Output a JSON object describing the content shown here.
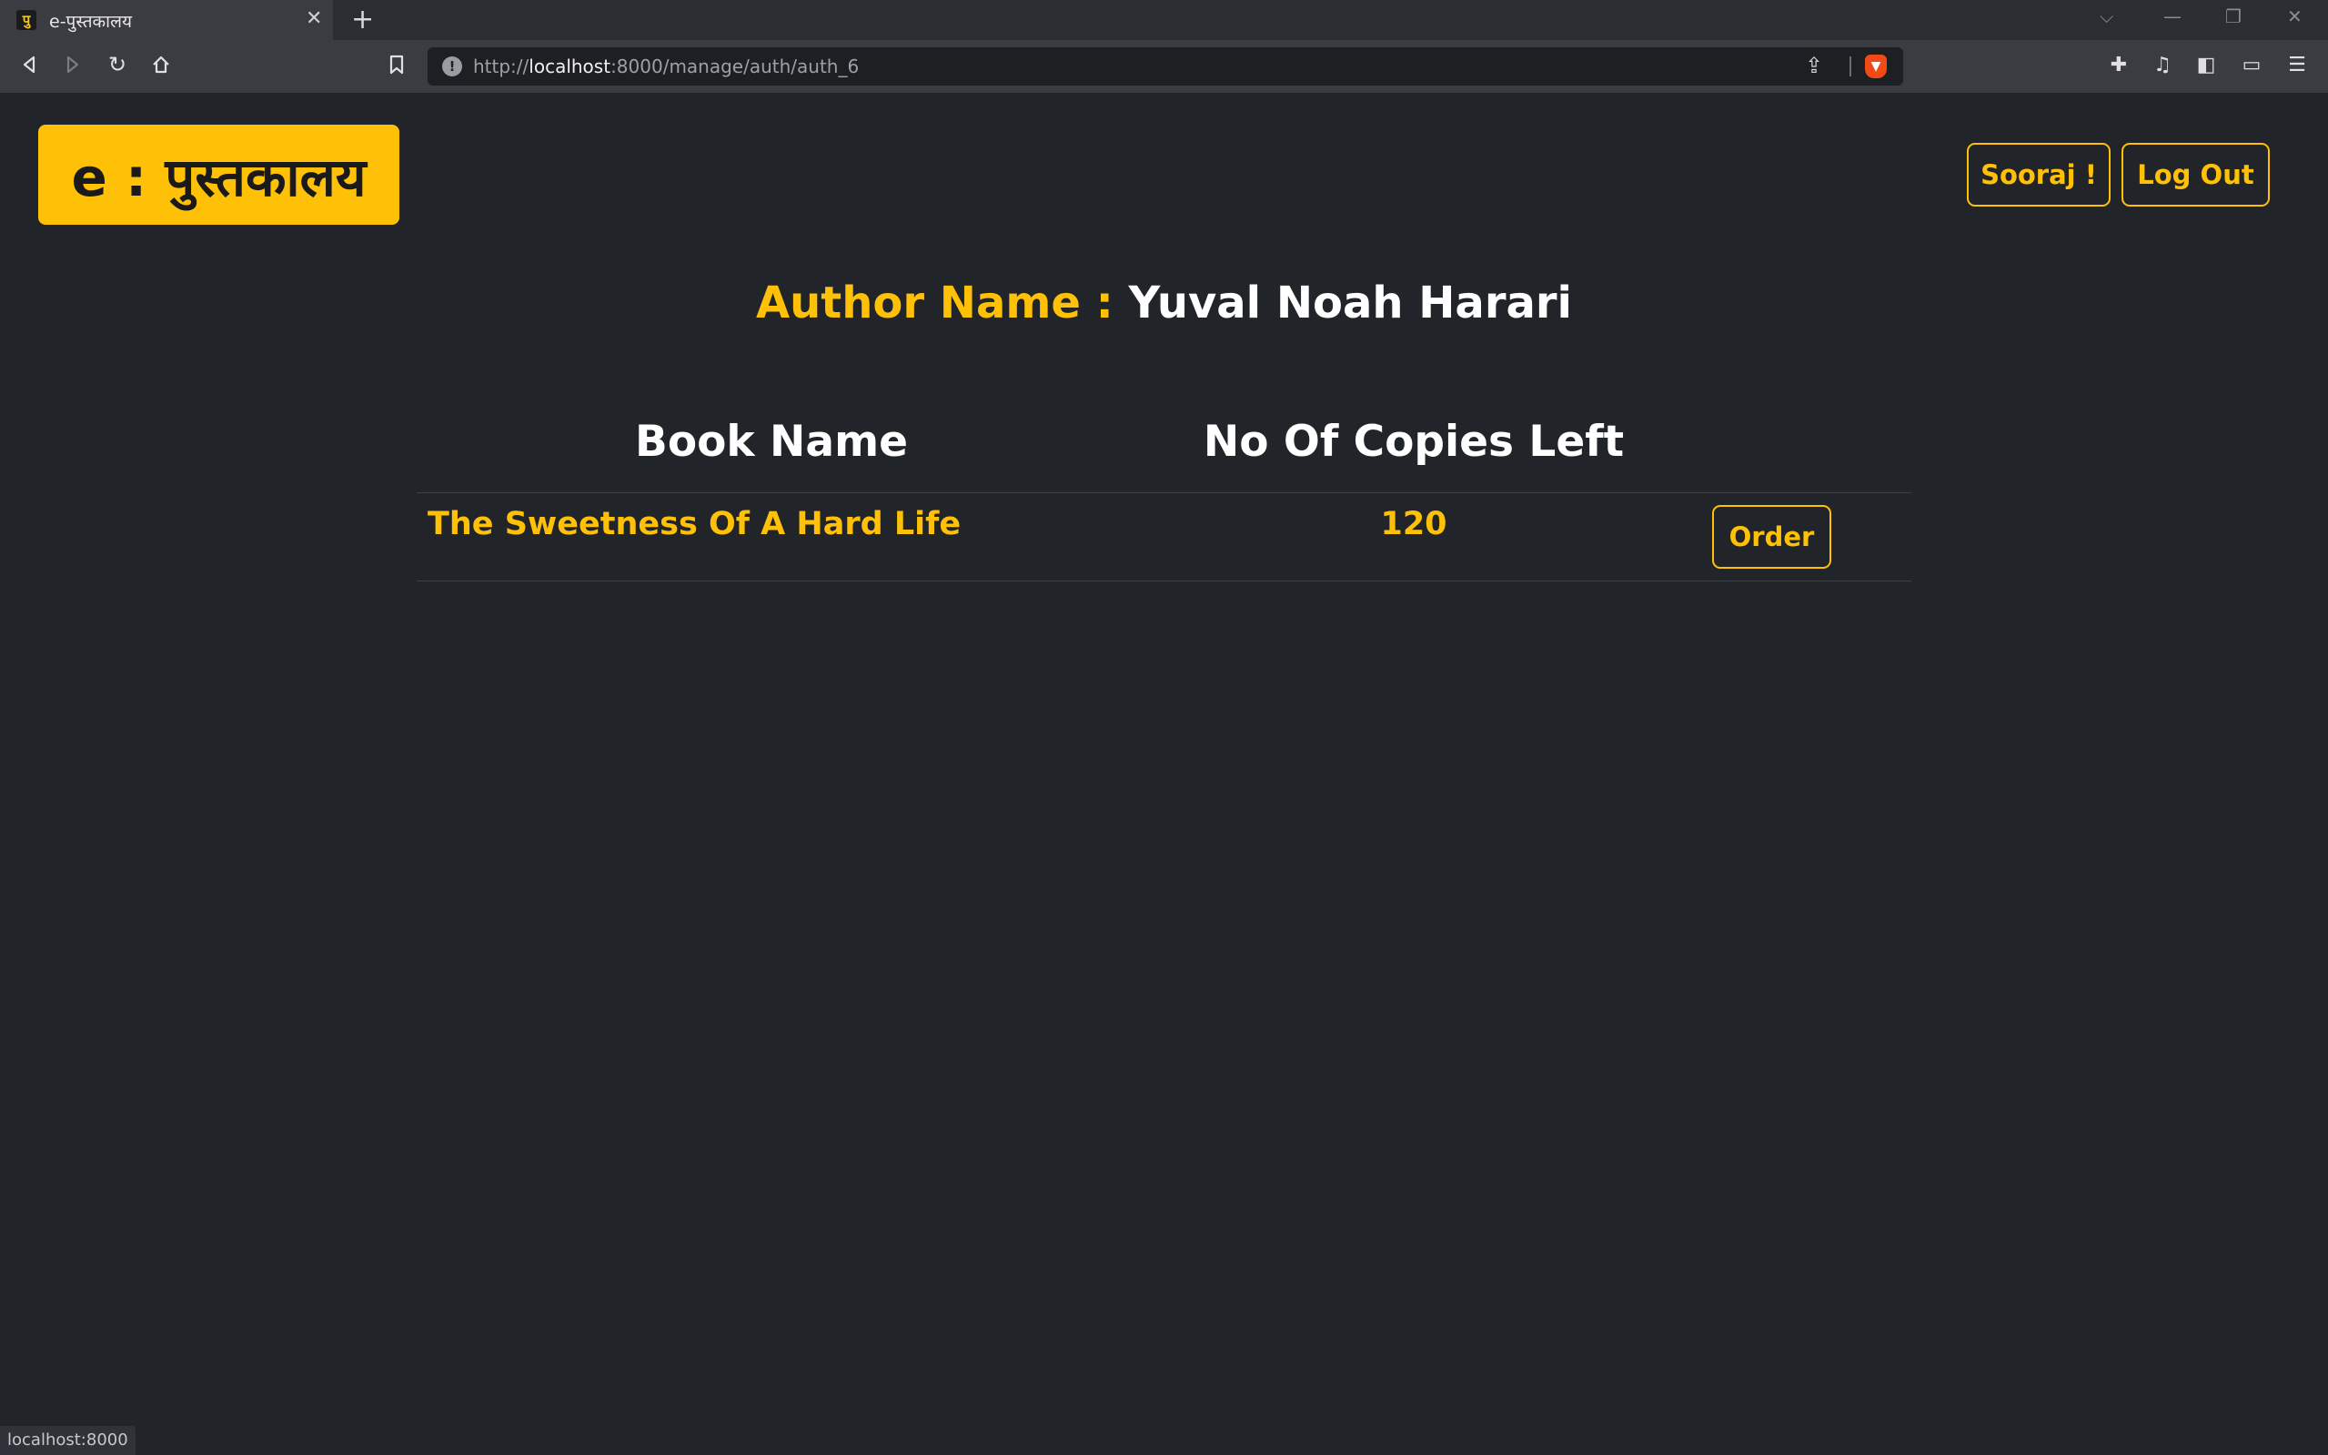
{
  "browser": {
    "tab_title": "e-पुस्तकालय",
    "tab_favicon": "पु",
    "url_scheme": "http://",
    "url_host": "localhost",
    "url_rest": ":8000/manage/auth/auth_6",
    "status_text": "localhost:8000"
  },
  "header": {
    "logo_text": "e : पुस्तकालय",
    "user_button": "Sooraj !",
    "logout_button": "Log Out"
  },
  "author": {
    "label": "Author Name :",
    "name": "Yuval Noah Harari"
  },
  "table": {
    "headers": [
      "Book Name",
      "No Of Copies Left"
    ],
    "rows": [
      {
        "book": "The Sweetness Of A Hard Life",
        "copies": "120",
        "action": "Order"
      }
    ]
  },
  "colors": {
    "accent": "#ffc107",
    "background": "#212429"
  }
}
